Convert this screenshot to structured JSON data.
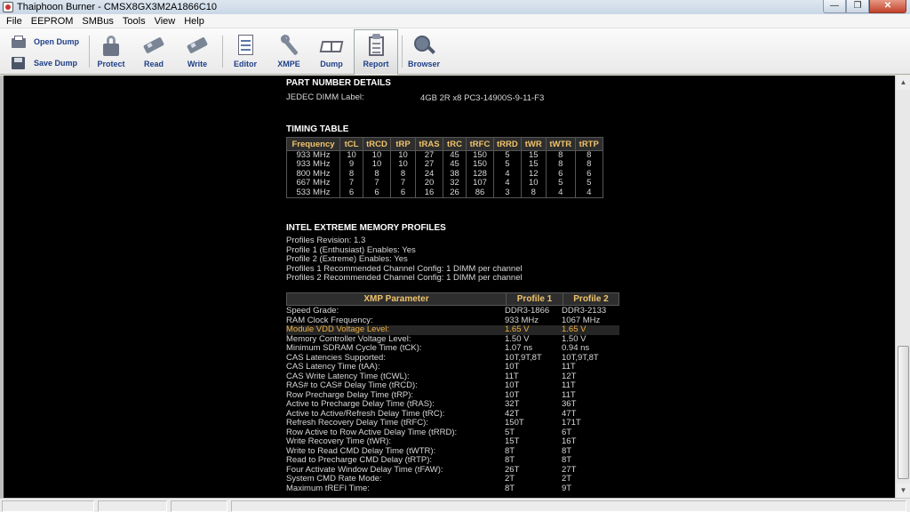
{
  "window": {
    "title": "Thaiphoon Burner - CMSX8GX3M2A1866C10"
  },
  "menu": [
    "File",
    "EEPROM",
    "SMBus",
    "Tools",
    "View",
    "Help"
  ],
  "toolbar": {
    "open_dump": "Open Dump",
    "save_dump": "Save Dump",
    "buttons": [
      "Protect",
      "Read",
      "Write",
      "Editor",
      "XMPE",
      "Dump",
      "Report",
      "Browser"
    ]
  },
  "report": {
    "part_number_heading": "PART NUMBER DETAILS",
    "jedec_label_key": "JEDEC DIMM Label:",
    "jedec_label_value": "4GB 2R x8 PC3-14900S-9-11-F3",
    "timing_heading": "TIMING TABLE",
    "timing_columns": [
      "Frequency",
      "tCL",
      "tRCD",
      "tRP",
      "tRAS",
      "tRC",
      "tRFC",
      "tRRD",
      "tWR",
      "tWTR",
      "tRTP"
    ],
    "timing_rows": [
      [
        "933 MHz",
        "10",
        "10",
        "10",
        "27",
        "45",
        "150",
        "5",
        "15",
        "8",
        "8"
      ],
      [
        "933 MHz",
        "9",
        "10",
        "10",
        "27",
        "45",
        "150",
        "5",
        "15",
        "8",
        "8"
      ],
      [
        "800 MHz",
        "8",
        "8",
        "8",
        "24",
        "38",
        "128",
        "4",
        "12",
        "6",
        "6"
      ],
      [
        "667 MHz",
        "7",
        "7",
        "7",
        "20",
        "32",
        "107",
        "4",
        "10",
        "5",
        "5"
      ],
      [
        "533 MHz",
        "6",
        "6",
        "6",
        "16",
        "26",
        "86",
        "3",
        "8",
        "4",
        "4"
      ]
    ],
    "xmp_heading": "INTEL EXTREME MEMORY PROFILES",
    "xmp_info": [
      "Profiles Revision: 1.3",
      "Profile 1 (Enthusiast) Enables: Yes",
      "Profile 2 (Extreme) Enables: Yes",
      "Profiles 1 Recommended Channel Config: 1 DIMM per channel",
      "Profiles 2 Recommended Channel Config: 1 DIMM per channel"
    ],
    "xmp_columns": [
      "XMP Parameter",
      "Profile 1",
      "Profile 2"
    ],
    "xmp_rows": [
      [
        "Speed Grade:",
        "DDR3-1866",
        "DDR3-2133"
      ],
      [
        "RAM Clock Frequency:",
        "933 MHz",
        "1067 MHz"
      ],
      [
        "Module VDD Voltage Level:",
        "1.65 V",
        "1.65 V"
      ],
      [
        "Memory Controller Voltage Level:",
        "1.50 V",
        "1.50 V"
      ],
      [
        "Minimum SDRAM Cycle Time (tCK):",
        "1.07 ns",
        "0.94 ns"
      ],
      [
        "CAS Latencies Supported:",
        "10T,9T,8T",
        "10T,9T,8T"
      ],
      [
        "CAS Latency Time (tAA):",
        "10T",
        "11T"
      ],
      [
        "CAS Write Latency Time (tCWL):",
        "11T",
        "12T"
      ],
      [
        "RAS# to CAS# Delay Time (tRCD):",
        "10T",
        "11T"
      ],
      [
        "Row Precharge Delay Time (tRP):",
        "10T",
        "11T"
      ],
      [
        "Active to Precharge Delay Time (tRAS):",
        "32T",
        "36T"
      ],
      [
        "Active to Active/Refresh Delay Time (tRC):",
        "42T",
        "47T"
      ],
      [
        "Refresh Recovery Delay Time (tRFC):",
        "150T",
        "171T"
      ],
      [
        "Row Active to Row Active Delay Time (tRRD):",
        "5T",
        "6T"
      ],
      [
        "Write Recovery Time (tWR):",
        "15T",
        "16T"
      ],
      [
        "Write to Read CMD Delay Time (tWTR):",
        "8T",
        "8T"
      ],
      [
        "Read to Precharge CMD Delay (tRTP):",
        "8T",
        "8T"
      ],
      [
        "Four Activate Window Delay Time (tFAW):",
        "26T",
        "27T"
      ],
      [
        "System CMD Rate Mode:",
        "2T",
        "2T"
      ],
      [
        "Maximum tREFI Time:",
        "8T",
        "9T"
      ]
    ],
    "highlighted_row": 2
  },
  "colors": {
    "accent_header": "#f0c36a",
    "highlight_text": "#f0b040",
    "background": "#000000"
  }
}
